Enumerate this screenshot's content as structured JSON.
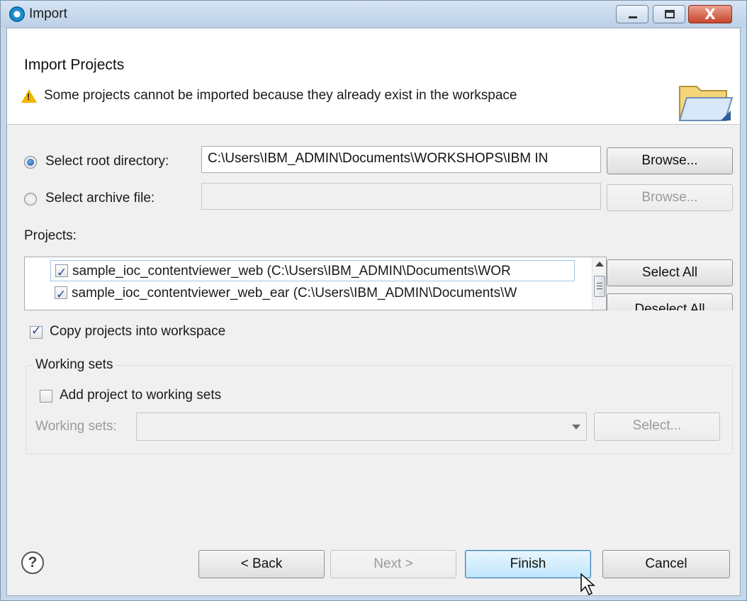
{
  "window": {
    "title": "Import",
    "controls": {
      "minimize": "minimize",
      "maximize": "maximize",
      "close": "X"
    }
  },
  "banner": {
    "title": "Import Projects",
    "message": "Some projects cannot be imported because they already exist in the workspace",
    "warning_icon": "warning-triangle-icon",
    "graphic_icon": "folder-icon"
  },
  "source": {
    "root_directory": {
      "label": "Select root directory:",
      "selected": true,
      "value": "C:\\Users\\IBM_ADMIN\\Documents\\WORKSHOPS\\IBM IN",
      "browse_label": "Browse..."
    },
    "archive_file": {
      "label": "Select archive file:",
      "selected": false,
      "value": "",
      "browse_label": "Browse..."
    }
  },
  "projects": {
    "label": "Projects:",
    "items": [
      {
        "checked": true,
        "label": "sample_ioc_contentviewer_web (C:\\Users\\IBM_ADMIN\\Documents\\WOR"
      },
      {
        "checked": true,
        "label": "sample_ioc_contentviewer_web_ear (C:\\Users\\IBM_ADMIN\\Documents\\W"
      }
    ],
    "select_all_label": "Select All",
    "deselect_all_label": "Deselect All"
  },
  "options": {
    "copy_into_workspace": {
      "label": "Copy projects into workspace",
      "checked": true
    }
  },
  "working_sets": {
    "legend": "Working sets",
    "add_to_sets": {
      "label": "Add project to working sets",
      "checked": false
    },
    "sets_label": "Working sets:",
    "sets_value": "",
    "select_label": "Select..."
  },
  "footer": {
    "help_icon": "?",
    "back_label": "< Back",
    "next_label": "Next >",
    "finish_label": "Finish",
    "cancel_label": "Cancel"
  },
  "colors": {
    "frame": "#c5d7eb",
    "panel": "#f0f0f0",
    "focus_button": "#bee6fd",
    "close_button": "#c8452d",
    "warning": "#f1b600"
  }
}
